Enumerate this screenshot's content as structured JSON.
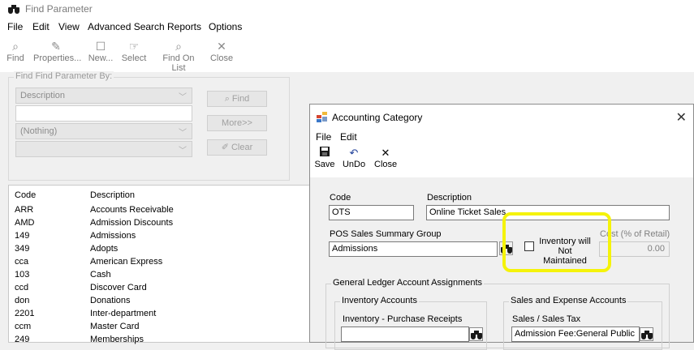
{
  "main_window": {
    "title": "Find Parameter",
    "menu": [
      "File",
      "Edit",
      "View",
      "Advanced Search",
      "Reports",
      "Options"
    ],
    "toolbar": {
      "find": "Find",
      "properties": "Properties...",
      "new": "New...",
      "select": "Select",
      "find_on_list": "Find On List",
      "close": "Close"
    },
    "find_group": {
      "legend": "Find Find Parameter By:",
      "field1_value": "Description",
      "field2_value": "",
      "field3_value": "(Nothing)",
      "field4_value": "",
      "find_button": "Find",
      "more_button": "More>>",
      "clear_button": "Clear"
    },
    "results": {
      "columns": [
        "Code",
        "Description"
      ],
      "rows": [
        {
          "code": "ARR",
          "description": "Accounts Receivable"
        },
        {
          "code": "AMD",
          "description": "Admission Discounts"
        },
        {
          "code": "149",
          "description": "Admissions"
        },
        {
          "code": "349",
          "description": "Adopts"
        },
        {
          "code": "cca",
          "description": "American Express"
        },
        {
          "code": "103",
          "description": "Cash"
        },
        {
          "code": "ccd",
          "description": "Discover Card"
        },
        {
          "code": "don",
          "description": "Donations"
        },
        {
          "code": "2201",
          "description": "Inter-department"
        },
        {
          "code": "ccm",
          "description": "Master Card"
        },
        {
          "code": "249",
          "description": "Memberships"
        }
      ]
    }
  },
  "dialog": {
    "title": "Accounting Category",
    "close_glyph": "✕",
    "menu": [
      "File",
      "Edit"
    ],
    "toolbar": {
      "save": "Save",
      "undo": "UnDo",
      "close": "Close"
    },
    "code_label": "Code",
    "code_value": "OTS",
    "description_label": "Description",
    "description_value": "Online Ticket Sales",
    "pos_label": "POS Sales Summary Group",
    "pos_value": "Admissions",
    "inventory_label_line1": "Inventory will",
    "inventory_label_line2": "Not Maintained",
    "cost_label": "Cost (% of Retail)",
    "cost_value": "0.00",
    "gl_legend": "General Ledger Account Assignments",
    "inventory_accounts_legend": "Inventory Accounts",
    "inventory_purchase_label": "Inventory - Purchase Receipts",
    "inventory_purchase_value": "",
    "sales_expense_legend": "Sales and Expense Accounts",
    "sales_tax_label": "Sales / Sales Tax",
    "sales_tax_value": "Admission Fee:General Public"
  },
  "colors": {
    "highlight": "#f5f30a",
    "window_bg": "#f0f0f0",
    "disabled_text": "#a0a0a0"
  }
}
